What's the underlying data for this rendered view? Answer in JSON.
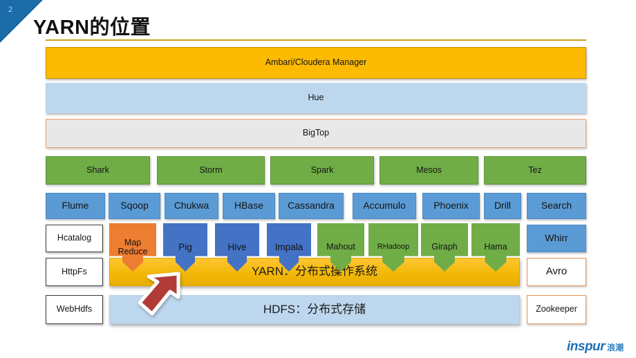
{
  "slide": {
    "number": "2",
    "title": "YARN的位置",
    "accent_gold": "#c8a227",
    "corner_blue": "#1b6ca8"
  },
  "stack": {
    "management_bar": "Ambari/Cloudera Manager",
    "ui_bar": "Hue",
    "packaging_bar": "BigTop"
  },
  "engines": [
    {
      "label": "Shark"
    },
    {
      "label": "Storm"
    },
    {
      "label": "Spark"
    },
    {
      "label": "Mesos"
    },
    {
      "label": "Tez"
    }
  ],
  "services": [
    {
      "label": "Flume"
    },
    {
      "label": "Sqoop"
    },
    {
      "label": "Chukwa"
    },
    {
      "label": "HBase"
    },
    {
      "label": "Cassandra"
    },
    {
      "label": "Accumulo"
    },
    {
      "label": "Phoenix"
    },
    {
      "label": "Drill"
    },
    {
      "label": "Search"
    }
  ],
  "frameworks": [
    {
      "label": "Map\nReduce",
      "line1": "Map",
      "line2": "Reduce",
      "color": "orange"
    },
    {
      "label": "Pig",
      "line1": "Pig",
      "line2": "",
      "color": "blue"
    },
    {
      "label": "Hive",
      "line1": "Hive",
      "line2": "",
      "color": "blue"
    },
    {
      "label": "Impala",
      "line1": "Impala",
      "line2": "",
      "color": "blue"
    },
    {
      "label": "Mahout",
      "line1": "Mahout",
      "line2": "",
      "color": "green"
    },
    {
      "label": "RHadoop",
      "line1": "RHadoop",
      "line2": "",
      "color": "green"
    },
    {
      "label": "Giraph",
      "line1": "Giraph",
      "line2": "",
      "color": "green"
    },
    {
      "label": "Hama",
      "line1": "Hama",
      "line2": "",
      "color": "green"
    }
  ],
  "left_column": [
    {
      "label": "Hcatalog"
    },
    {
      "label": "HttpFs"
    },
    {
      "label": "WebHdfs"
    }
  ],
  "right_column": [
    {
      "label": "Whirr"
    },
    {
      "label": "Avro"
    },
    {
      "label": "Zookeeper"
    }
  ],
  "core": {
    "yarn": "YARN：分布式操作系统",
    "hdfs": "HDFS：分布式存储"
  },
  "annotation": {
    "arrow": "red-up-right-arrow pointing at YARN layer"
  },
  "logo": {
    "en": "inspur",
    "cn": "浪潮",
    "color": "#1f6fb4"
  }
}
